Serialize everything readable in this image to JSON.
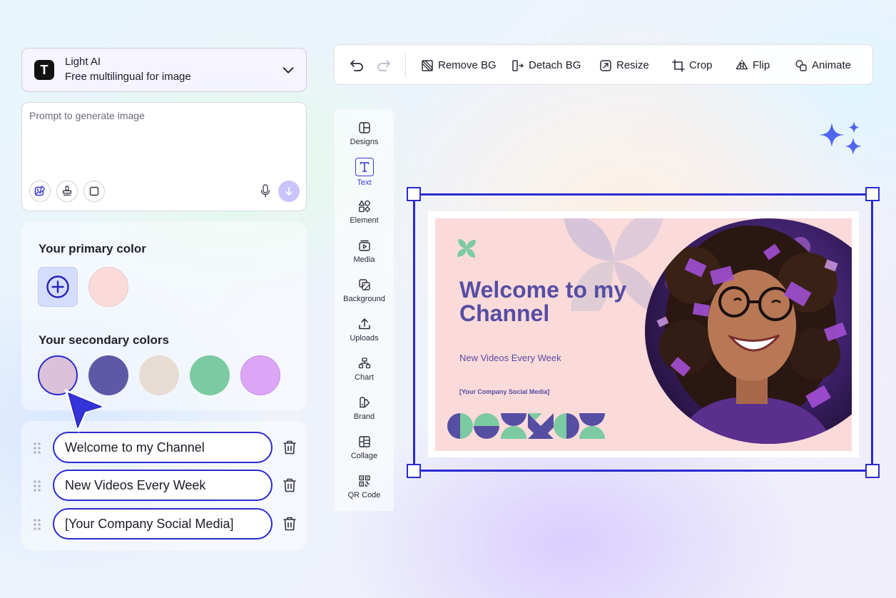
{
  "model": {
    "logo_letter": "T",
    "name": "Light AI",
    "description": "Free multilingual for image"
  },
  "prompt": {
    "placeholder": "Prompt to generate image"
  },
  "colors": {
    "primary_heading": "Your primary color",
    "primary_swatch": "#fbdada",
    "secondary_heading": "Your secondary colors",
    "secondary_swatches": [
      "#dcc2d8",
      "#5e58a6",
      "#e7dcd3",
      "#7ccaa1",
      "#dba6f6"
    ]
  },
  "text_fields": [
    "Welcome to my Channel",
    "New Videos Every Week",
    "[Your Company Social Media]"
  ],
  "toolbar": {
    "remove_bg": "Remove BG",
    "detach_bg": "Detach BG",
    "resize": "Resize",
    "crop": "Crop",
    "flip": "Flip",
    "animate": "Animate"
  },
  "side_tools": {
    "designs": "Designs",
    "text": "Text",
    "element": "Element",
    "media": "Media",
    "background": "Background",
    "uploads": "Uploads",
    "chart": "Chart",
    "brand": "Brand",
    "collage": "Collage",
    "qr_code": "QR Code"
  },
  "artwork": {
    "title": "Welcome to my Channel",
    "subtitle": "New Videos Every Week",
    "social": "[Your Company Social Media]",
    "accent_color": "#564ea3",
    "green_color": "#7ccaa1"
  },
  "theme": {
    "selection_color": "#2b2bcf"
  }
}
